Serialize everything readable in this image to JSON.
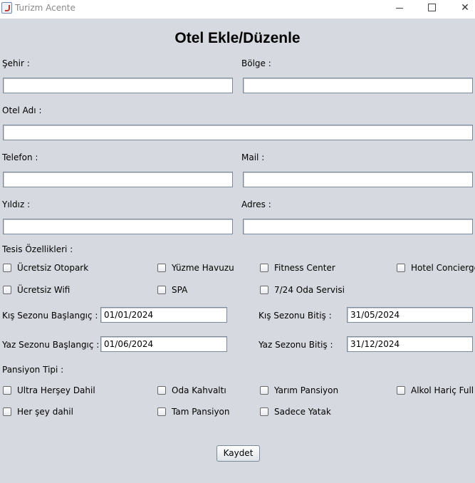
{
  "window": {
    "title": "Turizm Acente"
  },
  "form": {
    "title": "Otel Ekle/Düzenle",
    "labels": {
      "city": "Şehir :",
      "region": "Bölge :",
      "hotel_name": "Otel Adı :",
      "phone": "Telefon :",
      "mail": "Mail :",
      "stars": "Yıldız :",
      "address": "Adres :",
      "features": "Tesis Özellikleri :",
      "winter_start": "Kış Sezonu Başlangıç :",
      "winter_end": "Kış Sezonu Bitiş :",
      "summer_start": "Yaz Sezonu Başlangıç :",
      "summer_end": "Yaz Sezonu Bitiş :",
      "pension": "Pansiyon Tipi :"
    },
    "values": {
      "city": "",
      "region": "",
      "hotel_name": "",
      "phone": "",
      "mail": "",
      "stars": "",
      "address": "",
      "winter_start": "01/01/2024",
      "winter_end": "31/05/2024",
      "summer_start": "01/06/2024",
      "summer_end": "31/12/2024"
    },
    "features": [
      "Ücretsiz Otopark",
      "Yüzme Havuzu",
      "Fitness Center",
      "Hotel Concierge",
      "Ücretsiz Wifi",
      "SPA",
      "7/24 Oda Servisi"
    ],
    "pension_types": [
      "Ultra Herşey Dahil",
      "Oda Kahvaltı",
      "Yarım Pansiyon",
      "Alkol Hariç Full",
      "Her şey dahil",
      "Tam Pansiyon",
      "Sadece Yatak"
    ],
    "save_label": "Kaydet"
  }
}
